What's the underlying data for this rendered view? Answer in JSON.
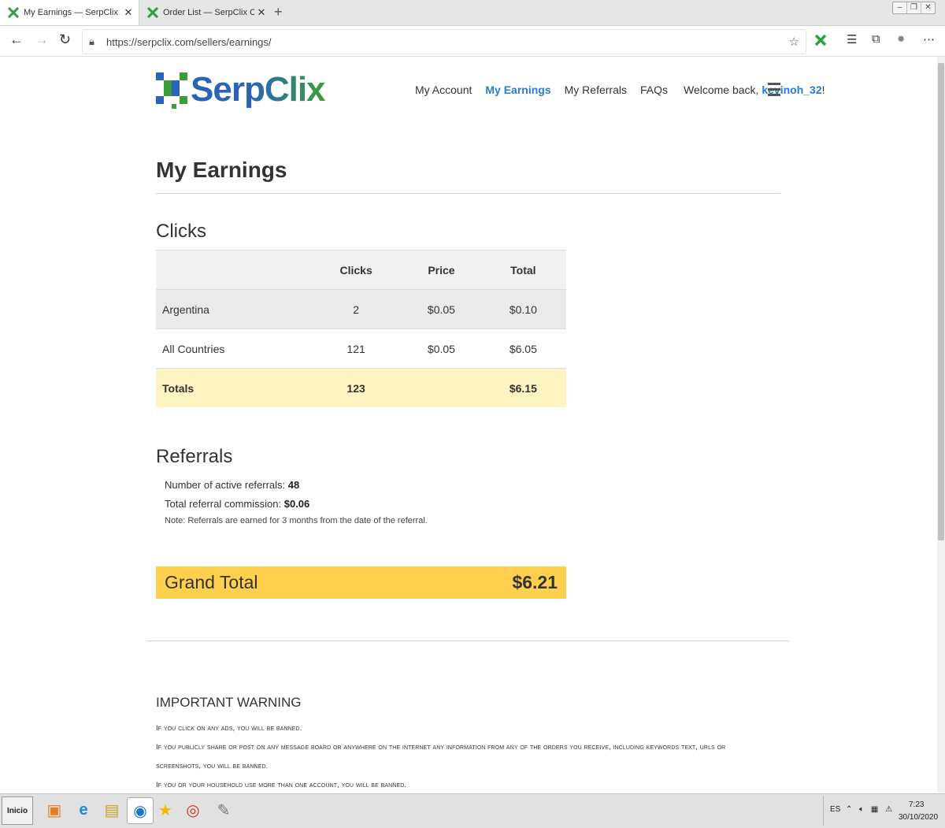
{
  "browser": {
    "tabs": [
      {
        "title": "My Earnings — SerpClix",
        "active": true
      },
      {
        "title": "Order List — SerpClix ClickSense",
        "active": false
      }
    ],
    "url": "https://serpclix.com/sellers/earnings/"
  },
  "header": {
    "logo_text": "SerpClix",
    "nav": {
      "my_account": "My Account",
      "my_earnings": "My Earnings",
      "my_referrals": "My Referrals",
      "faqs": "FAQs"
    },
    "welcome_prefix": "Welcome back,",
    "username": "kevinoh_32",
    "welcome_suffix": "!"
  },
  "page": {
    "title": "My Earnings"
  },
  "clicks": {
    "title": "Clicks",
    "columns": [
      "",
      "Clicks",
      "Price",
      "Total"
    ],
    "rows": [
      {
        "country": "Argentina",
        "clicks": "2",
        "price": "$0.05",
        "total": "$0.10"
      },
      {
        "country": "All Countries",
        "clicks": "121",
        "price": "$0.05",
        "total": "$6.05"
      }
    ],
    "totals": {
      "label": "Totals",
      "clicks": "123",
      "price": "",
      "total": "$6.15"
    }
  },
  "referrals": {
    "title": "Referrals",
    "active_label": "Number of active referrals:",
    "active_value": "48",
    "commission_label": "Total referral commission:",
    "commission_value": "$0.06",
    "note": "Note: Referrals are earned for 3 months from the date of the referral."
  },
  "grand_total": {
    "label": "Grand Total",
    "value": "$6.21"
  },
  "warning": {
    "title": "IMPORTANT WARNING",
    "lines": [
      "If you click on any ads, you will be banned.",
      "If you publicly share or post on any message board or anywhere on the internet any information from any of the orders you receive, including keywords text, urls or",
      "screenshots, you will be banned.",
      "If you or your household use more than one account, you will be banned."
    ]
  },
  "taskbar": {
    "start_label": "Inicio",
    "language": "ES",
    "time": "7:23",
    "date": "30/10/2020"
  },
  "colors": {
    "brand_blue": "#2a64b8",
    "brand_green": "#3a9f3a",
    "link_blue": "#2a7ad2",
    "totals_bg": "#fdf4c2",
    "grand_total_bg": "#fdd14e"
  }
}
